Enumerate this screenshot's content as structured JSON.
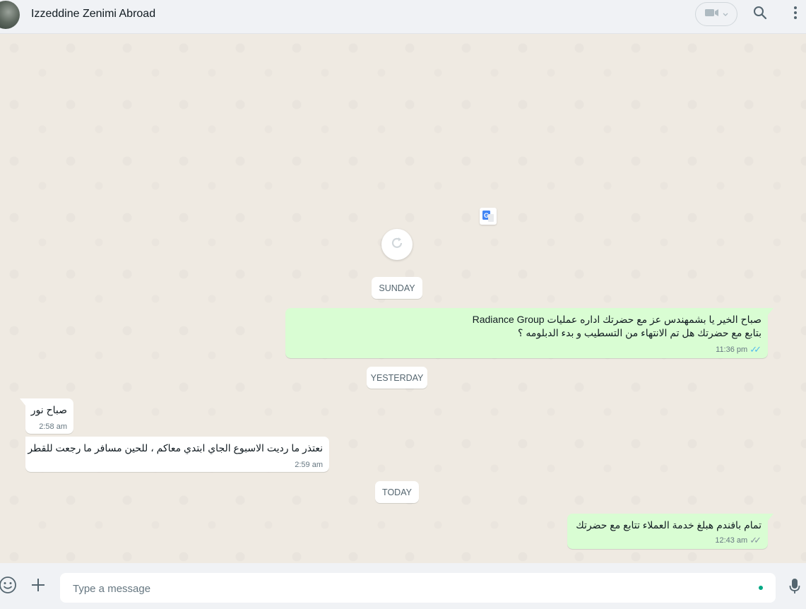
{
  "header": {
    "contact_name": "Izzeddine Zenimi Abroad",
    "icons": [
      "avatar",
      "video-call-icon",
      "chevron-down-icon",
      "search-icon",
      "menu-icon"
    ]
  },
  "chat": {
    "icons": [
      "translate-icon",
      "refresh-icon"
    ],
    "date_sunday": "SUNDAY",
    "date_yesterday": "YESTERDAY",
    "date_today": "TODAY",
    "messages": [
      {
        "direction": "out",
        "lines": [
          "صباح الخير يا بشمهندس عز مع  حضرتك اداره عمليات Radiance Group",
          "بتابع مع حضرتك هل تم الانتهاء من التسطيب و بدء الدبلومه ؟"
        ],
        "time": "11:36 pm",
        "status": "read"
      },
      {
        "direction": "in",
        "lines": [
          "صباح نور"
        ],
        "time": "2:58 am"
      },
      {
        "direction": "in",
        "lines": [
          "نعتذر ما رديت الاسبوع الجاي ابتدي معاكم ، للحين مسافر ما رجعت للقطر"
        ],
        "time": "2:59 am"
      },
      {
        "direction": "out",
        "lines": [
          "تمام بافندم هبلغ خدمة العملاء تتابع مع حضرتك"
        ],
        "time": "12:43 am",
        "status": "delivered"
      }
    ]
  },
  "footer": {
    "placeholder": "Type a message",
    "icons": [
      "emoji-icon",
      "attach-plus-icon",
      "microphone-icon"
    ]
  },
  "colors": {
    "outgoing_bubble": "#d9fdd3",
    "incoming_bubble": "#ffffff",
    "chat_background": "#efeae2",
    "read_ticks": "#53bdeb",
    "online_dot": "#00a884"
  }
}
